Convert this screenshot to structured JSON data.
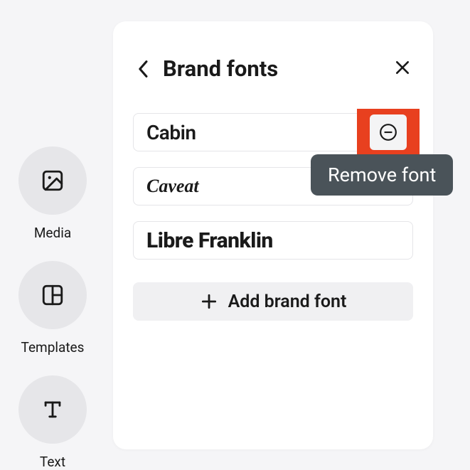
{
  "sidebar": {
    "items": [
      {
        "label": "Media",
        "icon": "image-icon"
      },
      {
        "label": "Templates",
        "icon": "layout-icon"
      },
      {
        "label": "Text",
        "icon": "text-icon"
      }
    ]
  },
  "panel": {
    "title": "Brand fonts",
    "fonts": [
      {
        "name": "Cabin",
        "highlighted": true
      },
      {
        "name": "Caveat",
        "highlighted": false
      },
      {
        "name": "Libre Franklin",
        "highlighted": false
      }
    ],
    "add_label": "Add brand font",
    "tooltip": "Remove font"
  }
}
